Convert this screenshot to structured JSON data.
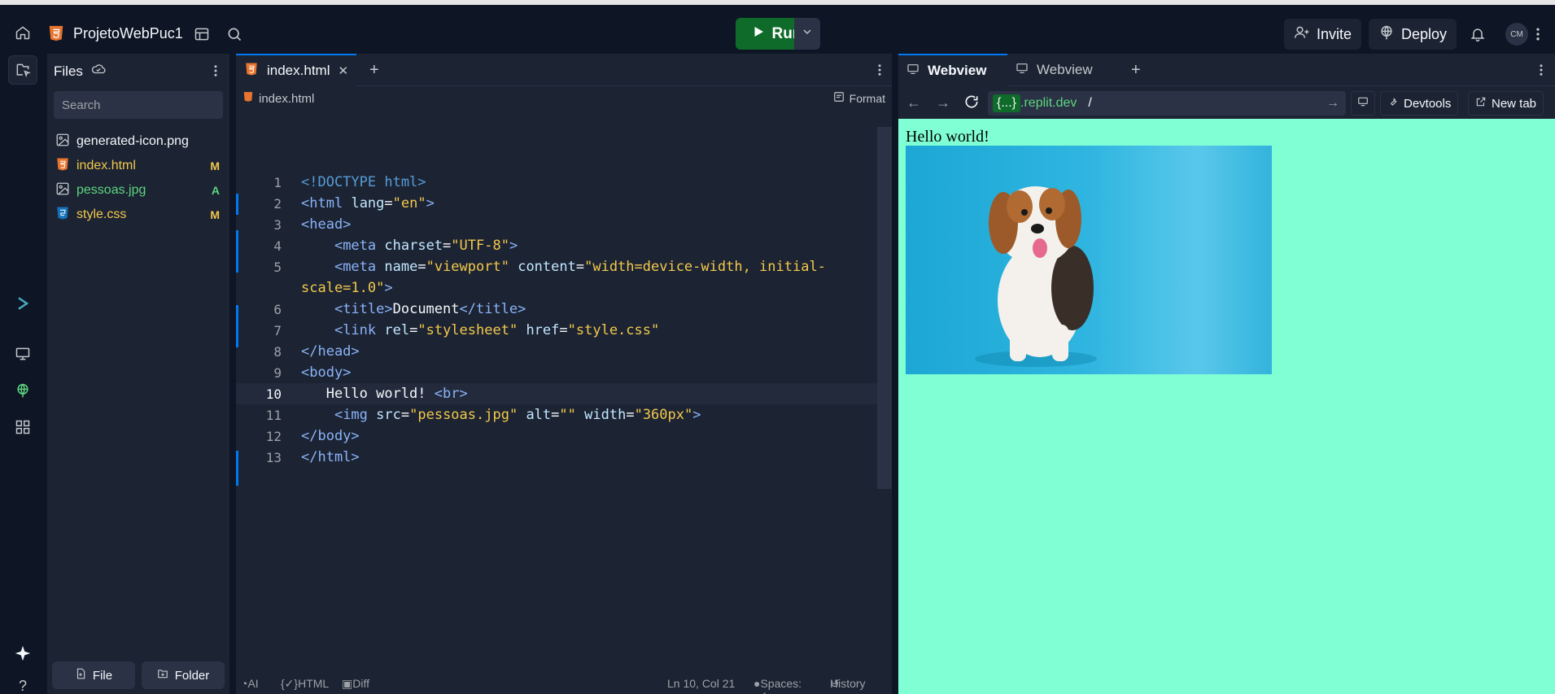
{
  "topbar": {
    "project_name": "ProjetoWebPuc1",
    "run_label": "Run",
    "invite_label": "Invite",
    "deploy_label": "Deploy",
    "avatar_initials": "CM"
  },
  "files": {
    "title": "Files",
    "search_placeholder": "Search",
    "items": [
      {
        "name": "generated-icon.png",
        "status": "",
        "color": "#f5f9fc"
      },
      {
        "name": "index.html",
        "status": "M",
        "color": "#f2c94c"
      },
      {
        "name": "pessoas.jpg",
        "status": "A",
        "color": "#5cd67f"
      },
      {
        "name": "style.css",
        "status": "M",
        "color": "#f2c94c"
      }
    ],
    "new_file_label": "File",
    "new_folder_label": "Folder"
  },
  "editor": {
    "tab_label": "index.html",
    "breadcrumb": "index.html",
    "format_label": "Format",
    "lines": [
      "1",
      "2",
      "3",
      "4",
      "5",
      "",
      "6",
      "7",
      "8",
      "9",
      "10",
      "11",
      "12",
      "13"
    ],
    "status": {
      "ai": "AI",
      "lang": "HTML",
      "diff": "Diff",
      "position": "Ln 10, Col 21",
      "spaces": "Spaces: 4",
      "history": "History"
    }
  },
  "webview": {
    "tab1": "Webview",
    "tab2": "Webview",
    "url_tag": "{...}",
    "url_domain": ".replit.dev",
    "url_path": "/",
    "devtools_label": "Devtools",
    "newtab_label": "New tab",
    "page_text": "Hello world!"
  },
  "colors": {
    "accent": "#0079f2",
    "run_green": "#0f6b2a",
    "preview_bg": "#80ffd5"
  }
}
